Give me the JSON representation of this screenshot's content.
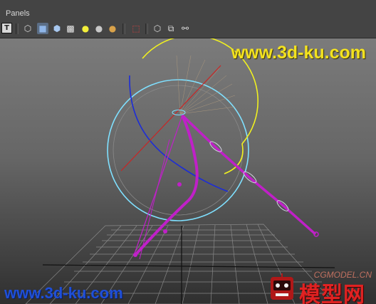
{
  "menubar": {
    "panels_label": "Panels"
  },
  "toolbar": {
    "items": [
      {
        "name": "texture-mode-icon",
        "glyph": "T"
      },
      {
        "name": "wireframe-cube-icon",
        "glyph": "⬡"
      },
      {
        "name": "smooth-shade-cube-icon",
        "glyph": "■"
      },
      {
        "name": "shaded-wire-cube-icon",
        "glyph": "⬢"
      },
      {
        "name": "checker-texture-icon",
        "glyph": "▩"
      },
      {
        "name": "light-yellow-icon",
        "glyph": "●"
      },
      {
        "name": "sphere-grey-icon",
        "glyph": "●"
      },
      {
        "name": "sphere-gold-icon",
        "glyph": "●"
      },
      {
        "name": "select-camera-icon",
        "glyph": "⬚"
      },
      {
        "name": "isolate-cube-icon",
        "glyph": "⬡"
      },
      {
        "name": "xray-icon",
        "glyph": "⧉"
      },
      {
        "name": "joints-icon",
        "glyph": "⚯"
      }
    ]
  },
  "watermarks": {
    "top": "www.3d-ku.com",
    "bottom": "www.3d-ku.com",
    "badge_site": "CGMODEL.CN",
    "badge_cn": "模型网"
  },
  "colors": {
    "rig": "#c020c8",
    "circle_cyan": "#7fe0ff",
    "arc_yellow": "#f0f020",
    "arc_blue": "#1c2cd8",
    "axis_red": "#d02020"
  }
}
